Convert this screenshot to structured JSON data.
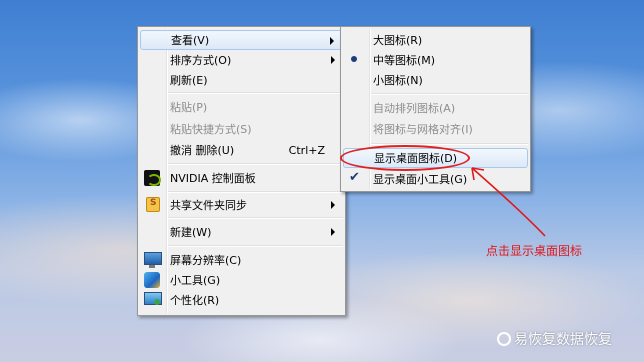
{
  "main_menu": {
    "items": [
      {
        "label": "查看(V)"
      },
      {
        "label": "排序方式(O)"
      },
      {
        "label": "刷新(E)"
      },
      {
        "label": "粘贴(P)"
      },
      {
        "label": "粘贴快捷方式(S)"
      },
      {
        "label": "撤消 删除(U)",
        "shortcut": "Ctrl+Z"
      },
      {
        "label": "NVIDIA 控制面板",
        "icon": "nvidia-icon"
      },
      {
        "label": "共享文件夹同步",
        "icon": "shared-folder-sync-icon"
      },
      {
        "label": "新建(W)"
      },
      {
        "label": "屏幕分辨率(C)",
        "icon": "monitor-icon"
      },
      {
        "label": "小工具(G)",
        "icon": "gadget-icon"
      },
      {
        "label": "个性化(R)",
        "icon": "personalize-icon"
      }
    ]
  },
  "view_submenu": {
    "items": [
      {
        "label": "大图标(R)"
      },
      {
        "label": "中等图标(M)",
        "selected": true
      },
      {
        "label": "小图标(N)"
      },
      {
        "label": "自动排列图标(A)"
      },
      {
        "label": "将图标与网格对齐(I)"
      },
      {
        "label": "显示桌面图标(D)"
      },
      {
        "label": "显示桌面小工具(G)",
        "checked": true
      }
    ]
  },
  "annotation": {
    "text": "点击显示桌面图标",
    "color": "#e01818"
  },
  "watermark": {
    "text": "易恢复数据恢复"
  },
  "colors": {
    "menu_bg": "#f0f0f0",
    "highlight_border": "#a8c8ec",
    "disabled_text": "#8d8d8d"
  }
}
